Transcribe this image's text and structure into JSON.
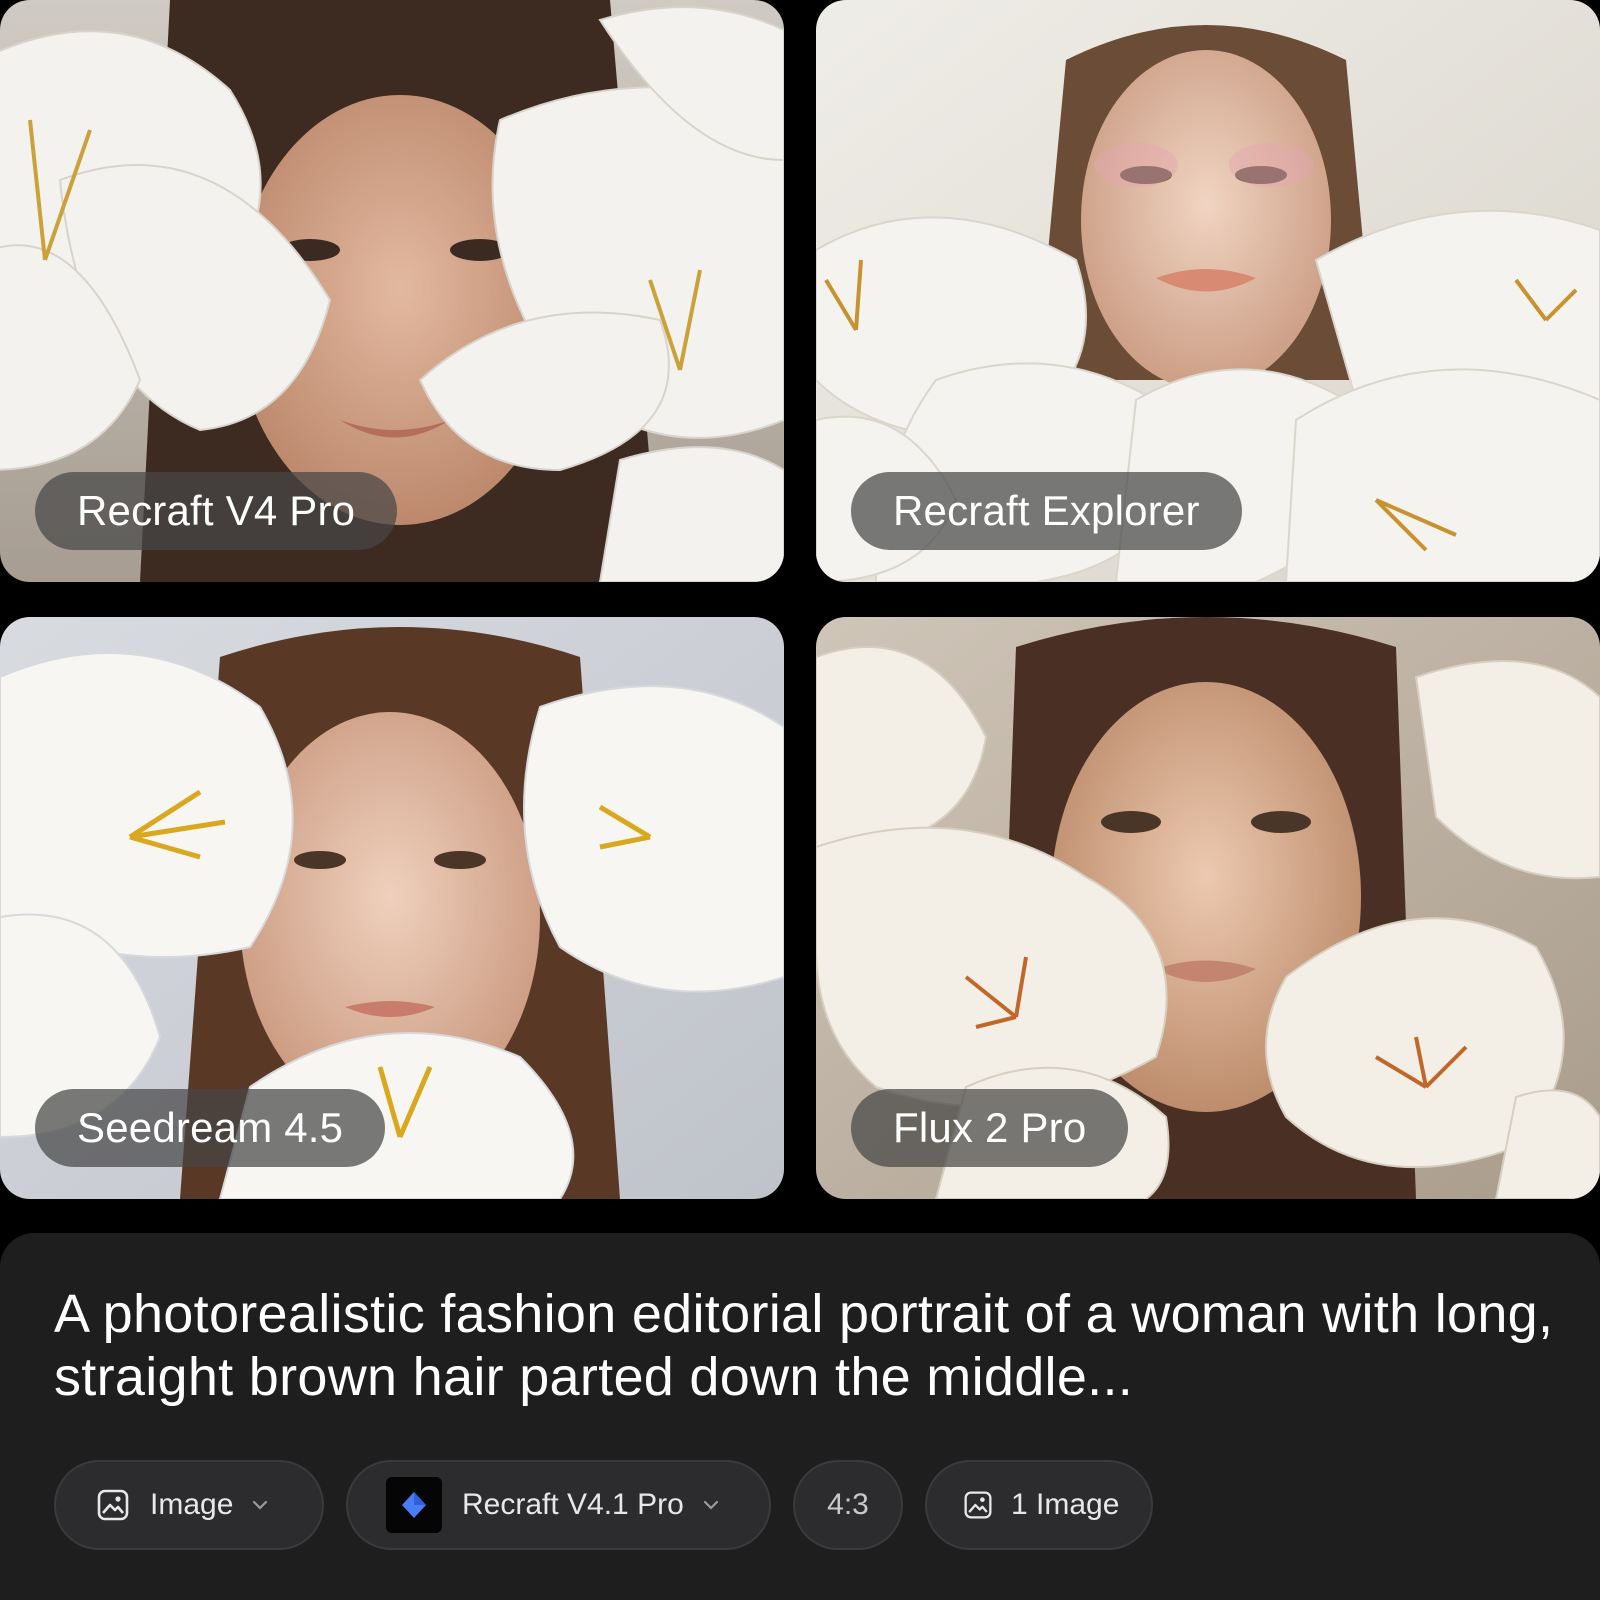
{
  "gallery": [
    {
      "model": "Recraft V4 Pro",
      "photo": "woman-with-white-lilies-portrait"
    },
    {
      "model": "Recraft Explorer",
      "photo": "woman-with-white-lilies-portrait"
    },
    {
      "model": "Seedream 4.5",
      "photo": "woman-with-white-lilies-portrait"
    },
    {
      "model": "Flux 2 Pro",
      "photo": "woman-with-white-lilies-portrait"
    }
  ],
  "prompt": {
    "text": "A photorealistic fashion editorial portrait of a woman with long, straight brown hair parted down the middle..."
  },
  "controls": {
    "type_label": "Image",
    "type_icon": "image-icon",
    "model_label": "Recraft V4.1 Pro",
    "model_icon": "diamond-logo-icon",
    "ratio_label": "4:3",
    "count_label": "1 Image",
    "count_icon": "image-icon"
  },
  "colors": {
    "background": "#000000",
    "panel": "#1e1e1f",
    "control": "#2c2c2e",
    "accent_logo": "#4a7cf5"
  }
}
